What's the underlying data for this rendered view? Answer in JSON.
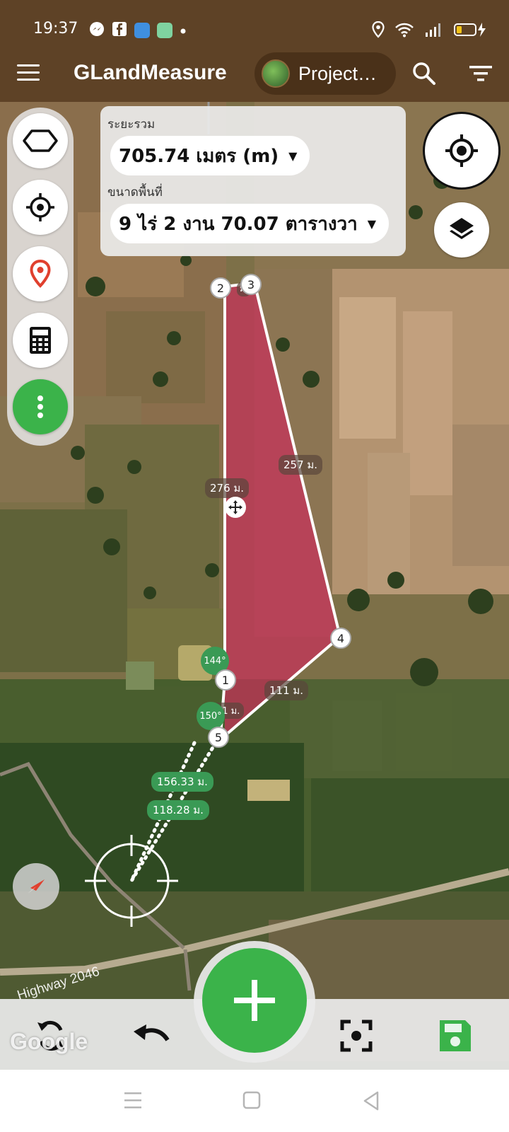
{
  "status_bar": {
    "time": "19:37",
    "notification_icons": [
      "messenger-icon",
      "facebook-icon",
      "app-blue-icon",
      "app-green-icon",
      "dot-icon"
    ],
    "system_icons": [
      "location-icon",
      "wifi-icon",
      "signal-icon",
      "battery-charging-icon"
    ]
  },
  "app_bar": {
    "title": "GLandMeasure",
    "project_label": "Project…",
    "icons": [
      "menu-icon",
      "search-icon",
      "filter-icon"
    ]
  },
  "measure": {
    "distance_label": "ระยะรวม",
    "distance_value": "705.74 เมตร (m)",
    "area_label": "ขนาดพื้นที่",
    "area_value": "9 ไร่ 2 งาน 70.07 ตารางวา"
  },
  "left_tools": [
    "polygon-icon",
    "crosshair-icon",
    "location-pin-icon",
    "calculator-icon",
    "more-vertical-icon"
  ],
  "map": {
    "points": [
      {
        "label": "1"
      },
      {
        "label": "2"
      },
      {
        "label": "3"
      },
      {
        "label": "4"
      },
      {
        "label": "5"
      }
    ],
    "edge_labels": [
      "276 ม.",
      "257 ม.",
      "111 ม.",
      "ม.",
      "41 ม."
    ],
    "angle_labels": [
      "144°",
      "150°"
    ],
    "guide_labels": [
      "156.33 ม.",
      "118.28 ม."
    ],
    "road_label": "Highway 2046",
    "attribution": "Google",
    "colors": {
      "polygon_fill": "#c8315a",
      "label_green": "#3a9a55"
    }
  },
  "bottom_bar": {
    "icons": [
      "refresh-icon",
      "undo-icon",
      "add-icon",
      "focus-icon",
      "save-icon"
    ],
    "accent": "#3bb34a"
  },
  "nav_bar": {
    "icons": [
      "recent-apps-icon",
      "home-icon",
      "back-icon"
    ]
  }
}
